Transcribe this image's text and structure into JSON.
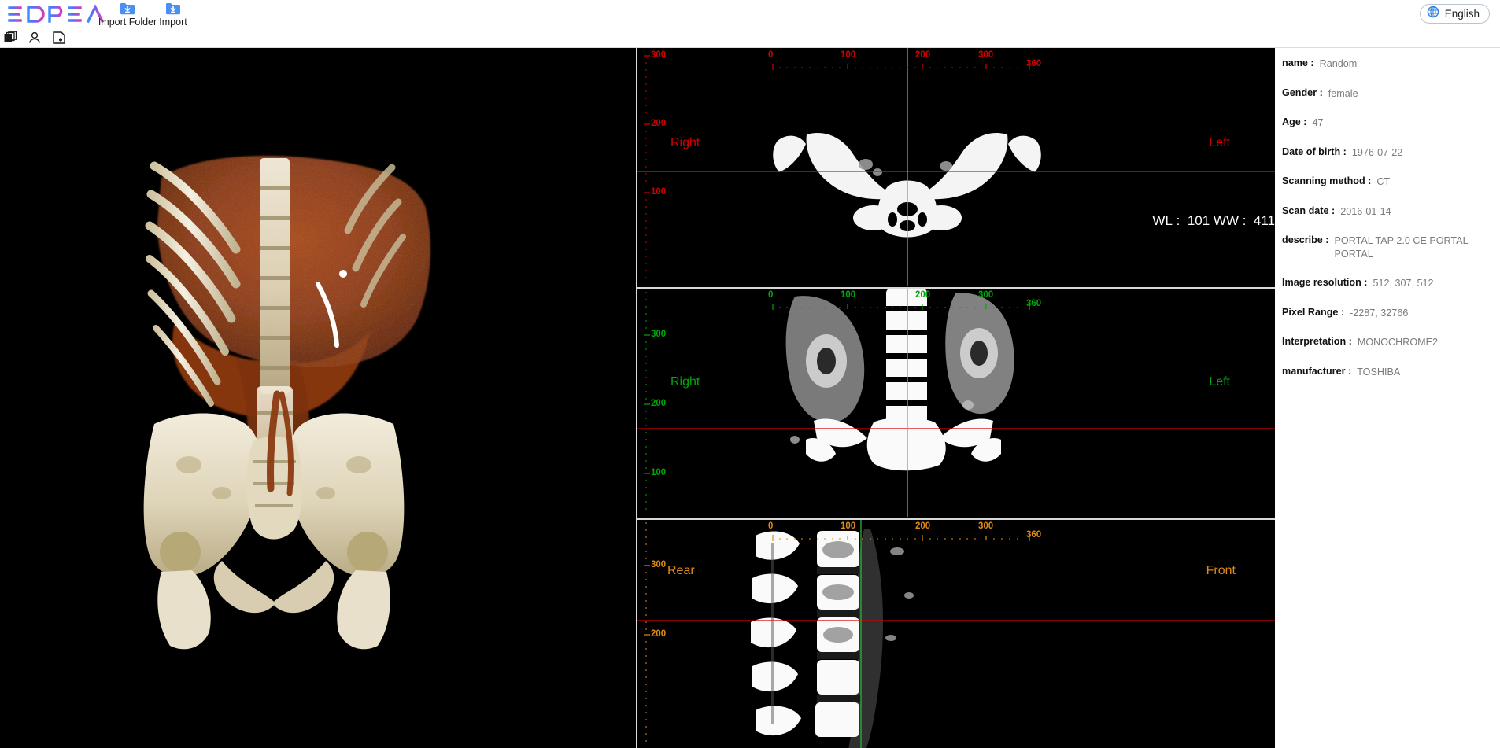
{
  "app": {
    "logo_text": "3DPEA",
    "logo_colors": [
      "#3d8bfd",
      "#5a6ff0",
      "#8b5ce0",
      "#b44ad0",
      "#d23bbd"
    ]
  },
  "toolbar": {
    "import_folder_label": "Import Folder",
    "import_label": "Import",
    "import_folder_icon": "folder-download-icon",
    "import_icon": "file-download-icon",
    "language_label": "English",
    "language_icon": "globe-icon"
  },
  "subtoolbar": {
    "items": [
      {
        "name": "layers-icon",
        "title": "Series"
      },
      {
        "name": "patient-icon",
        "title": "Patient"
      },
      {
        "name": "save-snapshot-icon",
        "title": "Snapshot"
      }
    ]
  },
  "patient_info": {
    "fields": [
      {
        "key": "name :",
        "value": "Random"
      },
      {
        "key": "Gender :",
        "value": "female"
      },
      {
        "key": "Age :",
        "value": "47"
      },
      {
        "key": "Date of birth :",
        "value": "1976-07-22"
      },
      {
        "key": "Scanning method :",
        "value": "CT"
      },
      {
        "key": "Scan date :",
        "value": "2016-01-14"
      },
      {
        "key": "describe :",
        "value": "PORTAL TAP 2.0 CE PORTAL PORTAL"
      },
      {
        "key": "Image resolution :",
        "value": "512, 307, 512"
      },
      {
        "key": "Pixel Range :",
        "value": "-2287, 32766"
      },
      {
        "key": "Interpretation :",
        "value": "MONOCHROME2"
      },
      {
        "key": "manufacturer :",
        "value": "TOSHIBA"
      }
    ]
  },
  "viewports": {
    "volume": {
      "name": "3d-volume-render",
      "label": ""
    },
    "axial": {
      "name": "axial-view",
      "ruler_color": "#d40000",
      "orientation_left": "Right",
      "orientation_right": "Left",
      "window_level_text": "WL :  101 WW :  411",
      "h_ticks": [
        "0",
        "100",
        "200",
        "300",
        "360"
      ],
      "v_ticks": [
        "300",
        "200",
        "100"
      ]
    },
    "coronal": {
      "name": "coronal-view",
      "ruler_color": "#00a60b",
      "orientation_left": "Right",
      "orientation_right": "Left",
      "h_ticks": [
        "0",
        "100",
        "200",
        "300",
        "360"
      ],
      "v_ticks": [
        "300",
        "200",
        "100"
      ]
    },
    "sagittal": {
      "name": "sagittal-view",
      "ruler_color": "#e08a16",
      "orientation_left": "Rear",
      "orientation_right": "Front",
      "h_ticks": [
        "0",
        "100",
        "200",
        "300",
        "360"
      ],
      "v_ticks": [
        "300",
        "200"
      ]
    }
  }
}
